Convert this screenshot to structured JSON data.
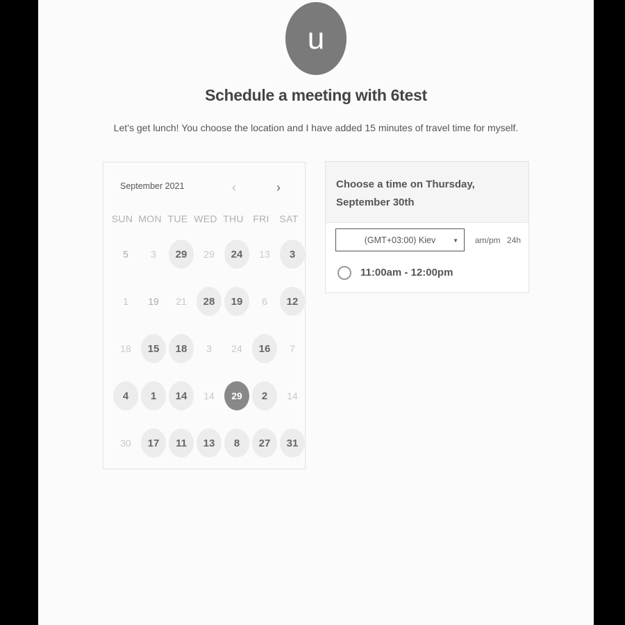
{
  "profile": {
    "avatar_letter": "u"
  },
  "header": {
    "title": "Schedule a meeting with 6test",
    "subtitle": "Let’s get lunch! You choose the location and I have added 15 minutes of travel time for myself."
  },
  "calendar": {
    "month_label": "September 2021",
    "prev_icon": "chevron-left-icon",
    "next_icon": "chevron-right-icon",
    "weekdays": [
      "SUN",
      "MON",
      "TUE",
      "WED",
      "THU",
      "FRI",
      "SAT"
    ],
    "weeks": [
      [
        {
          "d": "5",
          "s": "dim"
        },
        {
          "d": "3",
          "s": "none"
        },
        {
          "d": "29",
          "s": "avail"
        },
        {
          "d": "29",
          "s": "none"
        },
        {
          "d": "24",
          "s": "avail"
        },
        {
          "d": "13",
          "s": "none"
        },
        {
          "d": "3",
          "s": "avail"
        }
      ],
      [
        {
          "d": "1",
          "s": "none"
        },
        {
          "d": "19",
          "s": "dim"
        },
        {
          "d": "21",
          "s": "none"
        },
        {
          "d": "28",
          "s": "avail"
        },
        {
          "d": "19",
          "s": "avail"
        },
        {
          "d": "6",
          "s": "none"
        },
        {
          "d": "12",
          "s": "avail"
        }
      ],
      [
        {
          "d": "18",
          "s": "none"
        },
        {
          "d": "15",
          "s": "avail"
        },
        {
          "d": "18",
          "s": "avail"
        },
        {
          "d": "3",
          "s": "none"
        },
        {
          "d": "24",
          "s": "none"
        },
        {
          "d": "16",
          "s": "avail"
        },
        {
          "d": "7",
          "s": "none"
        }
      ],
      [
        {
          "d": "4",
          "s": "avail"
        },
        {
          "d": "1",
          "s": "avail"
        },
        {
          "d": "14",
          "s": "avail"
        },
        {
          "d": "14",
          "s": "none"
        },
        {
          "d": "29",
          "s": "sel"
        },
        {
          "d": "2",
          "s": "avail"
        },
        {
          "d": "14",
          "s": "none"
        }
      ],
      [
        {
          "d": "30",
          "s": "none"
        },
        {
          "d": "17",
          "s": "avail"
        },
        {
          "d": "11",
          "s": "avail"
        },
        {
          "d": "13",
          "s": "avail"
        },
        {
          "d": "8",
          "s": "avail"
        },
        {
          "d": "27",
          "s": "avail"
        },
        {
          "d": "31",
          "s": "avail"
        }
      ]
    ]
  },
  "time_panel": {
    "heading_line1": "Choose a time on Thursday,",
    "heading_line2": "September 30th",
    "timezone_value": "(GMT+03:00) Kiev",
    "format_12": "am/pm",
    "format_24": "24h",
    "slots": [
      {
        "label": "11:00am - 12:00pm"
      }
    ]
  }
}
